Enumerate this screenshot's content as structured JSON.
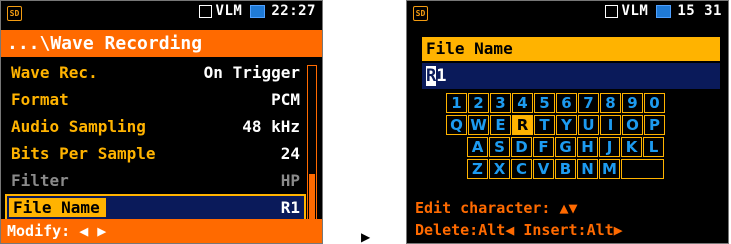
{
  "screen1": {
    "status": {
      "sd_icon": "sd-card-icon",
      "mode": "VLM",
      "time": "22:27"
    },
    "title": "...\\Wave Recording",
    "items": [
      {
        "label": "Wave Rec.",
        "value": "On Trigger",
        "state": "normal"
      },
      {
        "label": "Format",
        "value": "PCM",
        "state": "normal"
      },
      {
        "label": "Audio Sampling",
        "value": "48 kHz",
        "state": "normal"
      },
      {
        "label": "Bits Per Sample",
        "value": "24",
        "state": "normal"
      },
      {
        "label": "Filter",
        "value": "HP",
        "state": "disabled"
      },
      {
        "label": "File Name",
        "value": "R1",
        "state": "selected"
      }
    ],
    "footer": "Modify: ◀ ▶"
  },
  "transition_arrow": "▶",
  "screen2": {
    "status": {
      "sd_icon": "sd-card-icon",
      "mode": "VLM",
      "time": "15 31"
    },
    "field_label": "File Name",
    "field_value_cursor": "R",
    "field_value_rest": "1",
    "keyboard": {
      "row1": [
        "1",
        "2",
        "3",
        "4",
        "5",
        "6",
        "7",
        "8",
        "9",
        "0"
      ],
      "row2": [
        "Q",
        "W",
        "E",
        "R",
        "T",
        "Y",
        "U",
        "I",
        "O",
        "P"
      ],
      "row3": [
        "A",
        "S",
        "D",
        "F",
        "G",
        "H",
        "J",
        "K",
        "L"
      ],
      "row4": [
        "Z",
        "X",
        "C",
        "V",
        "B",
        "N",
        "M"
      ],
      "active_key": "R"
    },
    "help_edit": "Edit character: ▲▼",
    "help_delete_insert": "Delete:Alt◀ Insert:Alt▶"
  },
  "colors": {
    "accent_orange": "#ff6a00",
    "accent_yellow": "#ffb300",
    "key_blue": "#1d9bf0",
    "selection_navy": "#0a1a5a"
  }
}
